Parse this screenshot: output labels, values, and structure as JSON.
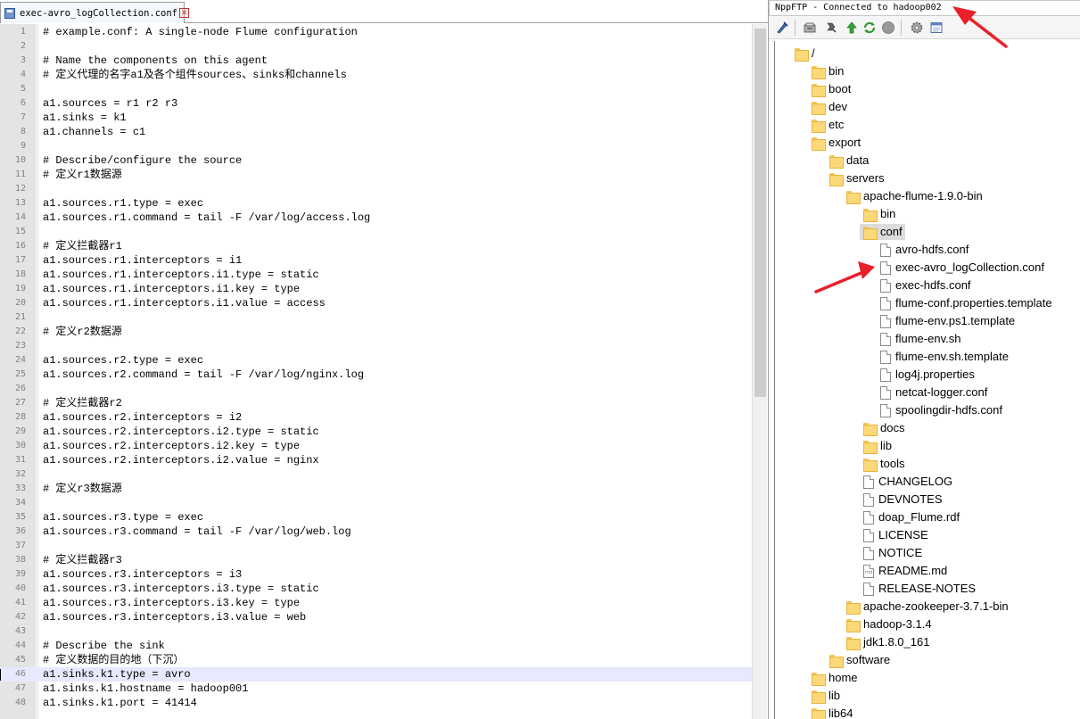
{
  "editor": {
    "tab_label": "exec-avro_logCollection.conf",
    "tab_close_glyph": "×",
    "lines": [
      "# example.conf: A single-node Flume configuration",
      "",
      "# Name the components on this agent",
      "# 定义代理的名字a1及各个组件sources、sinks和channels",
      "",
      "a1.sources = r1 r2 r3",
      "a1.sinks = k1",
      "a1.channels = c1",
      "",
      "# Describe/configure the source",
      "# 定义r1数据源",
      "",
      "a1.sources.r1.type = exec",
      "a1.sources.r1.command = tail -F /var/log/access.log",
      "",
      "# 定义拦截器r1",
      "a1.sources.r1.interceptors = i1",
      "a1.sources.r1.interceptors.i1.type = static",
      "a1.sources.r1.interceptors.i1.key = type",
      "a1.sources.r1.interceptors.i1.value = access",
      "",
      "# 定义r2数据源",
      "",
      "a1.sources.r2.type = exec",
      "a1.sources.r2.command = tail -F /var/log/nginx.log",
      "",
      "# 定义拦截器r2",
      "a1.sources.r2.interceptors = i2",
      "a1.sources.r2.interceptors.i2.type = static",
      "a1.sources.r2.interceptors.i2.key = type",
      "a1.sources.r2.interceptors.i2.value = nginx",
      "",
      "# 定义r3数据源",
      "",
      "a1.sources.r3.type = exec",
      "a1.sources.r3.command = tail -F /var/log/web.log",
      "",
      "# 定义拦截器r3",
      "a1.sources.r3.interceptors = i3",
      "a1.sources.r3.interceptors.i3.type = static",
      "a1.sources.r3.interceptors.i3.key = type",
      "a1.sources.r3.interceptors.i3.value = web",
      "",
      "# Describe the sink",
      "# 定义数据的目的地（下沉）",
      "a1.sinks.k1.type = avro",
      "a1.sinks.k1.hostname = hadoop001",
      "a1.sinks.k1.port = 41414"
    ],
    "current_line": 46
  },
  "ftp": {
    "title": "NppFTP - Connected to hadoop002",
    "toolbar_icons": [
      "connect-icon",
      "open-directory-icon",
      "download-icon",
      "upload-icon",
      "refresh-icon",
      "abort-icon",
      "settings-icon",
      "message-window-icon"
    ],
    "tree": [
      {
        "label": "/",
        "type": "folder",
        "depth": 0
      },
      {
        "label": "bin",
        "type": "folder",
        "depth": 1
      },
      {
        "label": "boot",
        "type": "folder",
        "depth": 1
      },
      {
        "label": "dev",
        "type": "folder",
        "depth": 1
      },
      {
        "label": "etc",
        "type": "folder",
        "depth": 1
      },
      {
        "label": "export",
        "type": "folder",
        "depth": 1
      },
      {
        "label": "data",
        "type": "folder",
        "depth": 2
      },
      {
        "label": "servers",
        "type": "folder",
        "depth": 2
      },
      {
        "label": "apache-flume-1.9.0-bin",
        "type": "folder",
        "depth": 3
      },
      {
        "label": "bin",
        "type": "folder",
        "depth": 4
      },
      {
        "label": "conf",
        "type": "folder",
        "depth": 4,
        "selected": true
      },
      {
        "label": "avro-hdfs.conf",
        "type": "file",
        "depth": 5
      },
      {
        "label": "exec-avro_logCollection.conf",
        "type": "file",
        "depth": 5
      },
      {
        "label": "exec-hdfs.conf",
        "type": "file",
        "depth": 5
      },
      {
        "label": "flume-conf.properties.template",
        "type": "file",
        "depth": 5
      },
      {
        "label": "flume-env.ps1.template",
        "type": "file",
        "depth": 5
      },
      {
        "label": "flume-env.sh",
        "type": "file",
        "depth": 5
      },
      {
        "label": "flume-env.sh.template",
        "type": "file",
        "depth": 5
      },
      {
        "label": "log4j.properties",
        "type": "file",
        "depth": 5
      },
      {
        "label": "netcat-logger.conf",
        "type": "file",
        "depth": 5
      },
      {
        "label": "spoolingdir-hdfs.conf",
        "type": "file",
        "depth": 5
      },
      {
        "label": "docs",
        "type": "folder",
        "depth": 4
      },
      {
        "label": "lib",
        "type": "folder",
        "depth": 4
      },
      {
        "label": "tools",
        "type": "folder",
        "depth": 4
      },
      {
        "label": "CHANGELOG",
        "type": "file",
        "depth": 4
      },
      {
        "label": "DEVNOTES",
        "type": "file",
        "depth": 4
      },
      {
        "label": "doap_Flume.rdf",
        "type": "file",
        "depth": 4
      },
      {
        "label": "LICENSE",
        "type": "file",
        "depth": 4
      },
      {
        "label": "NOTICE",
        "type": "file",
        "depth": 4
      },
      {
        "label": "README.md",
        "type": "file-md",
        "depth": 4
      },
      {
        "label": "RELEASE-NOTES",
        "type": "file",
        "depth": 4
      },
      {
        "label": "apache-zookeeper-3.7.1-bin",
        "type": "folder",
        "depth": 3
      },
      {
        "label": "hadoop-3.1.4",
        "type": "folder",
        "depth": 3
      },
      {
        "label": "jdk1.8.0_161",
        "type": "folder",
        "depth": 3
      },
      {
        "label": "software",
        "type": "folder",
        "depth": 2
      },
      {
        "label": "home",
        "type": "folder",
        "depth": 1
      },
      {
        "label": "lib",
        "type": "folder",
        "depth": 1
      },
      {
        "label": "lib64",
        "type": "folder",
        "depth": 1
      }
    ]
  },
  "colors": {
    "annotation_arrow": "#e8202a",
    "current_line": "#e8e8ff",
    "gutter": "#e4e4e4",
    "folder": "#fbd878"
  }
}
